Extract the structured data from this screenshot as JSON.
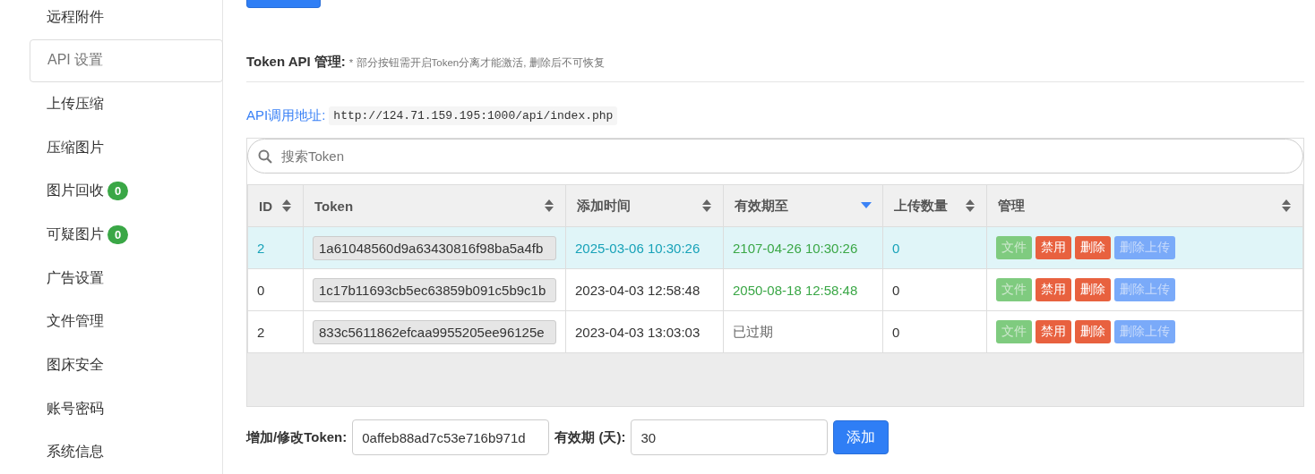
{
  "sidebar": {
    "items": [
      {
        "label": "远程附件",
        "selected": false
      },
      {
        "label": "API 设置",
        "selected": true
      },
      {
        "label": "上传压缩",
        "selected": false
      },
      {
        "label": "压缩图片",
        "selected": false
      },
      {
        "label": "图片回收",
        "selected": false,
        "badge": "0"
      },
      {
        "label": "可疑图片",
        "selected": false,
        "badge": "0"
      },
      {
        "label": "广告设置",
        "selected": false
      },
      {
        "label": "文件管理",
        "selected": false
      },
      {
        "label": "图床安全",
        "selected": false
      },
      {
        "label": "账号密码",
        "selected": false
      },
      {
        "label": "系统信息",
        "selected": false
      }
    ]
  },
  "section": {
    "title": "Token API 管理:",
    "note": "* 部分按钮需开启Token分离才能激活, 删除后不可恢复"
  },
  "api_address": {
    "label": "API调用地址:",
    "value": "http://124.71.159.195:1000/api/index.php"
  },
  "table": {
    "search": {
      "placeholder": "搜索Token"
    },
    "columns": [
      {
        "label": "ID",
        "sorted": false
      },
      {
        "label": "Token",
        "sorted": false
      },
      {
        "label": "添加时间",
        "sorted": false
      },
      {
        "label": "有效期至",
        "sorted": true
      },
      {
        "label": "上传数量",
        "sorted": false
      },
      {
        "label": "管理",
        "sorted": false
      }
    ],
    "rows": [
      {
        "selected": true,
        "id": "2",
        "token": "1a61048560d9a63430816f98ba5a4fb",
        "added": "2025-03-06 10:30:26",
        "expires": "2107-04-26 10:30:26",
        "expired": false,
        "uploads": "0",
        "actions": [
          {
            "label": "文件",
            "kind": "success",
            "disabled": true
          },
          {
            "label": "禁用",
            "kind": "danger",
            "disabled": false
          },
          {
            "label": "删除",
            "kind": "danger",
            "disabled": false
          },
          {
            "label": "删除上传",
            "kind": "primary",
            "disabled": true
          }
        ]
      },
      {
        "selected": false,
        "id": "0",
        "token": "1c17b11693cb5ec63859b091c5b9c1b",
        "added": "2023-04-03 12:58:48",
        "expires": "2050-08-18 12:58:48",
        "expired": false,
        "uploads": "0",
        "actions": [
          {
            "label": "文件",
            "kind": "success",
            "disabled": true
          },
          {
            "label": "禁用",
            "kind": "danger",
            "disabled": false
          },
          {
            "label": "删除",
            "kind": "danger",
            "disabled": false
          },
          {
            "label": "删除上传",
            "kind": "primary",
            "disabled": true
          }
        ]
      },
      {
        "selected": false,
        "id": "2",
        "token": "833c5611862efcaa9955205ee96125e",
        "added": "2023-04-03 13:03:03",
        "expires": "已过期",
        "expired": true,
        "uploads": "0",
        "actions": [
          {
            "label": "文件",
            "kind": "success",
            "disabled": true
          },
          {
            "label": "禁用",
            "kind": "danger",
            "disabled": false
          },
          {
            "label": "删除",
            "kind": "danger",
            "disabled": false
          },
          {
            "label": "删除上传",
            "kind": "primary",
            "disabled": true
          }
        ]
      }
    ]
  },
  "form": {
    "token_label": "增加/修改Token:",
    "token_value": "0affeb88ad7c53e716b971d",
    "days_label": "有效期 (天):",
    "days_value": "30",
    "submit": "添加"
  }
}
